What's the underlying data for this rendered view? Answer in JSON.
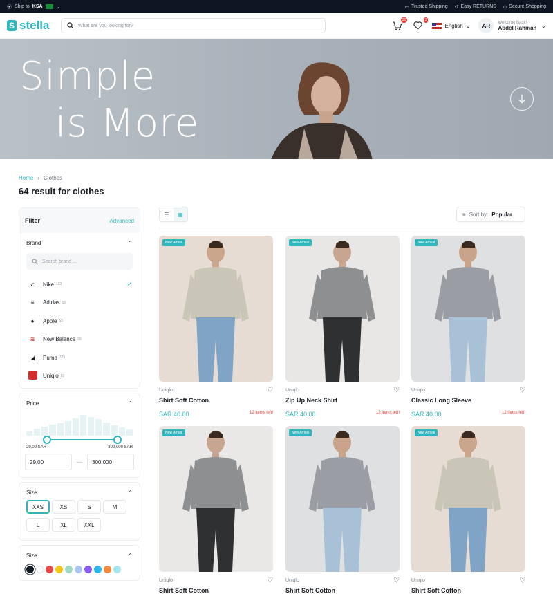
{
  "topbar": {
    "ship_prefix": "Ship to",
    "ship_country": "KSA",
    "links": [
      "Trusted Shipping",
      "Easy RETURNS",
      "Secure Shopping"
    ]
  },
  "header": {
    "logo": "stella",
    "search_placeholder": "What are you looking for?",
    "cart_count": "20",
    "wishlist_count": "3",
    "language": "English",
    "user_initials": "AR",
    "welcome": "Welcome Back!",
    "user_name": "Abdel Rahman"
  },
  "hero": {
    "line1": "Simple",
    "line2": "is More"
  },
  "breadcrumb": {
    "home": "Home",
    "current": "Clothes"
  },
  "results_title": "64 result for clothes",
  "filter": {
    "title": "Filter",
    "advanced": "Advanced",
    "brand_label": "Brand",
    "brand_search_placeholder": "Search brand ...",
    "brands": [
      {
        "name": "Nike",
        "count": "123",
        "mark": "✓"
      },
      {
        "name": "Adidas",
        "count": "55",
        "mark": ""
      },
      {
        "name": "Apple",
        "count": "65",
        "mark": ""
      },
      {
        "name": "New Balance",
        "count": "99",
        "mark": ""
      },
      {
        "name": "Puma",
        "count": "325",
        "mark": ""
      },
      {
        "name": "Uniqlo",
        "count": "61",
        "mark": ""
      }
    ],
    "price_label": "Price",
    "price_min_label": "29,00 SAR",
    "price_max_label": "300,000 SAR",
    "price_min_value": "29,00",
    "price_max_value": "300,000",
    "size_label": "Size",
    "sizes": [
      "XXS",
      "XS",
      "S",
      "M",
      "L",
      "XL",
      "XXL"
    ],
    "selected_size": "XXS",
    "color_label": "Size",
    "colors": [
      "#141c26",
      "#ffffff",
      "#e84a4a",
      "#f5c518",
      "#9fd9c3",
      "#a9c8f0",
      "#8a5cf0",
      "#2fb6e8",
      "#f08a3c",
      "#a7e6ef"
    ]
  },
  "toolbar": {
    "sort_prefix": "Sort by:",
    "sort_value": "Popular"
  },
  "products": [
    {
      "tag": "New Arrival",
      "brand": "Uniqlo",
      "name": "Shirt Soft Cotton",
      "price": "SAR 40.00",
      "stock": "12 items left!",
      "bg": "#e7dcd3",
      "shirt": "#c9c6b8",
      "pants": "#7fa4c6",
      "skin": "#caa68c"
    },
    {
      "tag": "New Arrival",
      "brand": "Uniqlo",
      "name": "Zip Up Neck Shirt",
      "price": "SAR 40.00",
      "stock": "12 items left!",
      "bg": "#e9e7e5",
      "shirt": "#8e8f91",
      "pants": "#2e3032",
      "skin": "#c8a590"
    },
    {
      "tag": "New Arrival",
      "brand": "Uniqlo",
      "name": "Classic Long Sleeve",
      "price": "SAR 40.00",
      "stock": "12 items left!",
      "bg": "#dfe0e2",
      "shirt": "#9a9ea4",
      "pants": "#a9c1d6",
      "skin": "#c9a48b"
    },
    {
      "tag": "New Arrival",
      "brand": "Uniqlo",
      "name": "Shirt Soft Cotton",
      "bg": "#e9e8e6",
      "shirt": "#8e8f91",
      "pants": "#2e3032",
      "skin": "#c8a590"
    },
    {
      "tag": "New Arrival",
      "brand": "Uniqlo",
      "name": "Shirt Soft Cotton",
      "bg": "#dfe0e2",
      "shirt": "#9a9ea4",
      "pants": "#a9c1d6",
      "skin": "#c9a48b"
    },
    {
      "tag": "New Arrival",
      "brand": "Uniqlo",
      "name": "Shirt Soft Cotton",
      "bg": "#e7dcd3",
      "shirt": "#c9c6b8",
      "pants": "#7fa4c6",
      "skin": "#caa68c"
    }
  ]
}
